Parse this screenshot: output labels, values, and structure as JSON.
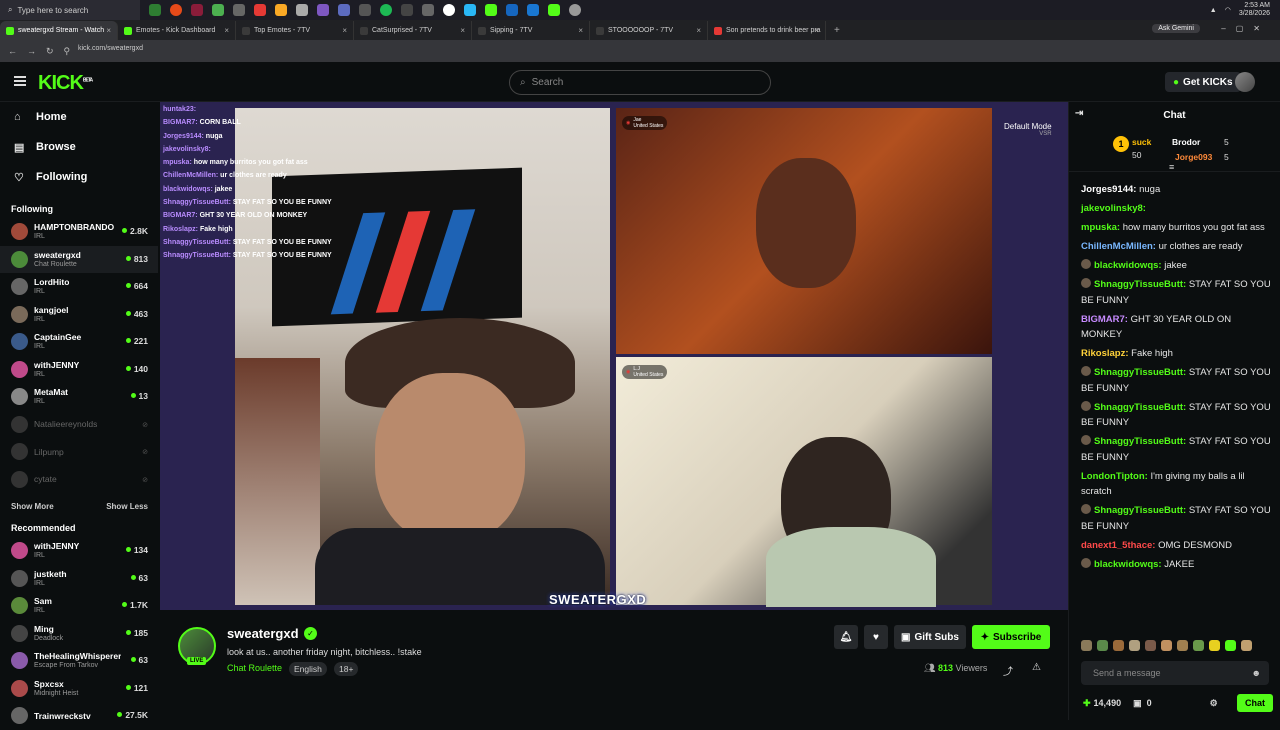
{
  "taskbar": {
    "search_placeholder": "Type here to search",
    "time": "2:53 AM",
    "date": "3/28/2026"
  },
  "browser": {
    "tabs": [
      {
        "label": "sweatergxd Stream - Watch"
      },
      {
        "label": "Emotes - Kick Dashboard"
      },
      {
        "label": "Top Emotes - 7TV"
      },
      {
        "label": "CatSurprised - 7TV"
      },
      {
        "label": "Sipping - 7TV"
      },
      {
        "label": "STOOOOOOP - 7TV"
      },
      {
        "label": "Son pretends to drink beer pra"
      }
    ],
    "ask_label": "Ask Gemini",
    "url": "kick.com/sweatergxd"
  },
  "header": {
    "logo": "KICK",
    "logo_sup": "BETA",
    "search_placeholder": "Search",
    "get_kicks": "Get KICKs"
  },
  "sidebar": {
    "nav": [
      {
        "label": "Home",
        "icon": "home-icon"
      },
      {
        "label": "Browse",
        "icon": "browse-icon"
      },
      {
        "label": "Following",
        "icon": "heart-icon"
      }
    ],
    "following_title": "Following",
    "following": [
      {
        "name": "HAMPTONBRANDO",
        "cat": "IRL",
        "viewers": "2.8K",
        "color": "#a04a3a"
      },
      {
        "name": "sweatergxd",
        "cat": "Chat Roulette",
        "viewers": "813",
        "color": "#4c8b3a"
      },
      {
        "name": "LordHito",
        "cat": "IRL",
        "viewers": "664",
        "color": "#666"
      },
      {
        "name": "kangjoel",
        "cat": "IRL",
        "viewers": "463",
        "color": "#7a6a5a"
      },
      {
        "name": "CaptainGee",
        "cat": "IRL",
        "viewers": "221",
        "color": "#3a5a8a"
      },
      {
        "name": "withJENNY",
        "cat": "IRL",
        "viewers": "140",
        "color": "#c04a8a"
      },
      {
        "name": "MetaMat",
        "cat": "IRL",
        "viewers": "13",
        "color": "#888"
      }
    ],
    "offline": [
      "Natalieereynolds",
      "Lilpump",
      "cytate"
    ],
    "show_more": "Show More",
    "show_less": "Show Less",
    "recommended_title": "Recommended",
    "recommended": [
      {
        "name": "withJENNY",
        "cat": "IRL",
        "viewers": "134",
        "color": "#c04a8a"
      },
      {
        "name": "justketh",
        "cat": "IRL",
        "viewers": "63",
        "color": "#555"
      },
      {
        "name": "Sam",
        "cat": "IRL",
        "viewers": "1.7K",
        "color": "#5a8a3a"
      },
      {
        "name": "Ming",
        "cat": "Deadlock",
        "viewers": "185",
        "color": "#444"
      },
      {
        "name": "TheHealingWhisperer",
        "cat": "Escape From Tarkov",
        "viewers": "63",
        "color": "#8a5aaa"
      },
      {
        "name": "Spxcsx",
        "cat": "Midnight Heist",
        "viewers": "121",
        "color": "#aa4a4a"
      },
      {
        "name": "Trainwreckstv",
        "cat": "",
        "viewers": "27.5K",
        "color": "#666"
      }
    ]
  },
  "video": {
    "overlay_chat": [
      {
        "user": "huntak23:",
        "text": ""
      },
      {
        "user": "BIGMAR7:",
        "text": " CORN BALL"
      },
      {
        "user": "Jorges9144:",
        "text": " nuga"
      },
      {
        "user": "jakevolinsky8:",
        "text": ""
      },
      {
        "user": "mpuska:",
        "text": " how many burritos you got fat ass"
      },
      {
        "user": "ChillenMcMillen:",
        "text": " ur clothes are ready"
      },
      {
        "user": "blackwidowqs:",
        "text": " jakee"
      },
      {
        "user": "ShnaggyTissueButt:",
        "text": " STAY FAT SO YOU BE FUNNY"
      },
      {
        "user": "BIGMAR7:",
        "text": " GHT 30 YEAR OLD ON MONKEY"
      },
      {
        "user": "Rikoslapz:",
        "text": " Fake high"
      },
      {
        "user": "ShnaggyTissueButt:",
        "text": " STAY FAT SO YOU BE FUNNY"
      },
      {
        "user": "ShnaggyTissueButt:",
        "text": " STAY FAT SO YOU BE FUNNY"
      }
    ],
    "mode": "Default Mode",
    "mode_sub": "VSR",
    "peer1": "Jae",
    "peer1_loc": "United States",
    "peer2": "L.J",
    "peer2_loc": "United States",
    "watermark": "SWEATERGXD"
  },
  "channel": {
    "name": "sweatergxd",
    "live": "LIVE",
    "title": "look at us.. another friday night, bitchless.. !stake",
    "category": "Chat Roulette",
    "tags": [
      "English",
      "18+"
    ],
    "gift_subs": "Gift Subs",
    "subscribe": "Subscribe",
    "viewers": "813",
    "viewers_label": "Viewers"
  },
  "chat": {
    "title": "Chat",
    "leaderboard": {
      "top_user": "suck",
      "top_value": "50",
      "second": "Brodor",
      "second_value": "5",
      "third": "Jorge093",
      "third_value": "5"
    },
    "messages": [
      {
        "user": "Jorges9144:",
        "text": " nuga",
        "color": "#ffffff",
        "badge": false
      },
      {
        "user": "jakevolinsky8:",
        "text": "",
        "color": "#53fc18",
        "badge": false
      },
      {
        "user": "mpuska:",
        "text": " how many burritos you got fat ass",
        "color": "#53fc18",
        "badge": false
      },
      {
        "user": "ChillenMcMillen:",
        "text": " ur clothes are ready",
        "color": "#7ab8ff",
        "badge": false
      },
      {
        "user": "blackwidowqs:",
        "text": " jakee",
        "color": "#53fc18",
        "badge": true
      },
      {
        "user": "ShnaggyTissueButt:",
        "text": " STAY FAT SO YOU BE FUNNY",
        "color": "#53fc18",
        "badge": true
      },
      {
        "user": "BIGMAR7:",
        "text": " GHT 30 YEAR OLD ON MONKEY",
        "color": "#c78bff",
        "badge": false
      },
      {
        "user": "Rikoslapz:",
        "text": " Fake high",
        "color": "#ffd23a",
        "badge": false
      },
      {
        "user": "ShnaggyTissueButt:",
        "text": " STAY FAT SO YOU BE FUNNY",
        "color": "#53fc18",
        "badge": true
      },
      {
        "user": "ShnaggyTissueButt:",
        "text": " STAY FAT SO YOU BE FUNNY",
        "color": "#53fc18",
        "badge": true
      },
      {
        "user": "ShnaggyTissueButt:",
        "text": " STAY FAT SO YOU BE FUNNY",
        "color": "#53fc18",
        "badge": true
      },
      {
        "user": "LondonTipton:",
        "text": " I'm giving my balls a lil scratch",
        "color": "#53fc18",
        "badge": false
      },
      {
        "user": "ShnaggyTissueButt:",
        "text": " STAY FAT SO YOU BE FUNNY",
        "color": "#53fc18",
        "badge": true
      },
      {
        "user": "danext1_5thace:",
        "text": " OMG DESMOND",
        "color": "#ff4a4a",
        "badge": false
      },
      {
        "user": "blackwidowqs:",
        "text": " JAKEE",
        "color": "#53fc18",
        "badge": true
      }
    ],
    "send_placeholder": "Send a message",
    "kicks": "14,490",
    "gifts": "0",
    "chat_button": "Chat"
  },
  "colors": {
    "brand": "#53fc18",
    "bg": "#0b0e0f",
    "video_frame": "#2a2350"
  }
}
